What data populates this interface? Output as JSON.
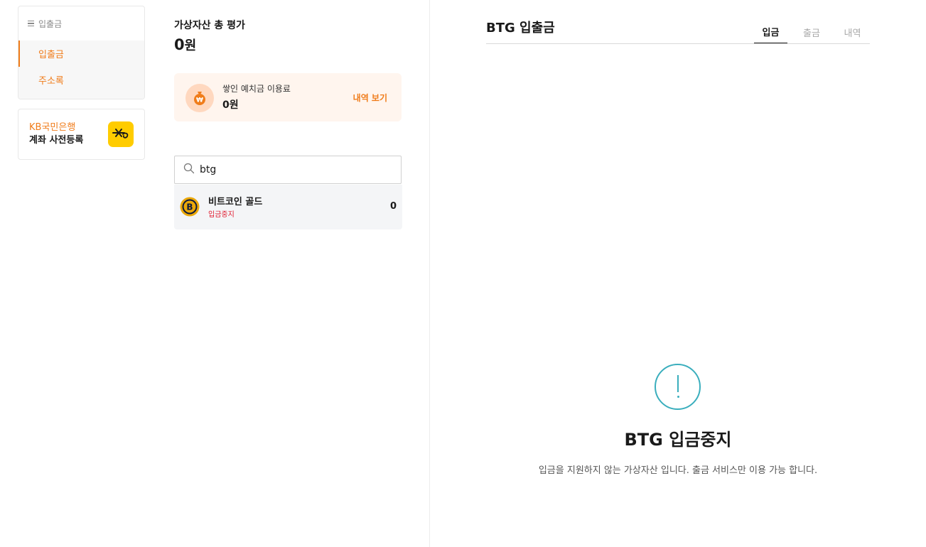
{
  "nav": {
    "header": "입출금",
    "items": [
      {
        "label": "입출금",
        "active": true
      },
      {
        "label": "주소록",
        "active": false
      }
    ]
  },
  "kb_banner": {
    "line1": "KB국민은행",
    "line2": "계좌 사전등록"
  },
  "assets": {
    "total_label": "가상자산 총 평가",
    "total_value": "0",
    "total_unit": "원"
  },
  "fee": {
    "label": "쌓인 예치금 이용료",
    "value": "0원",
    "link": "내역 보기"
  },
  "search": {
    "value": "btg"
  },
  "coins": [
    {
      "name": "비트코인 골드",
      "status": "입금중지",
      "amount": "0"
    }
  ],
  "panel": {
    "title": "BTG 입출금",
    "tabs": [
      {
        "label": "입금",
        "active": true
      },
      {
        "label": "출금",
        "active": false
      },
      {
        "label": "내역",
        "active": false
      }
    ]
  },
  "notice": {
    "title": "BTG 입금중지",
    "description": "입금을 지원하지 않는 가상자산 입니다. 출금 서비스만 이용 가능 합니다."
  },
  "colors": {
    "accent": "#f07c1a",
    "status_red": "#e0182c",
    "notice_teal": "#3aaebd",
    "kb_yellow": "#ffcc00"
  }
}
